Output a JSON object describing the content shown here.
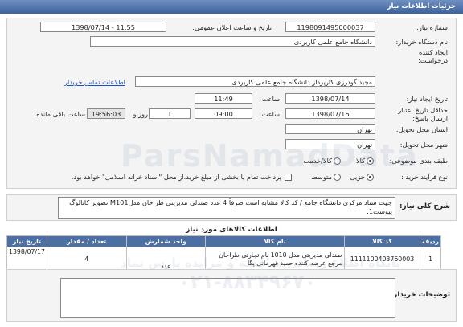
{
  "title": "جزئیات اطلاعات نیاز",
  "form": {
    "need_number": {
      "label": "شماره نیاز:",
      "value": "1198091495000037"
    },
    "announce_datetime": {
      "label": "تاریخ و ساعت اعلان عمومی:",
      "value": "1398/07/14 - 11:55"
    },
    "buyer_org": {
      "label": "نام دستگاه خریدار:",
      "value": "دانشگاه جامع علمی کاربردی"
    },
    "request_creator": {
      "label": "ایجاد کننده درخواست:",
      "value": "مجید گودرزی کارپرداز دانشگاه جامع علمی کاربردی",
      "contact_link": "اطلاعات تماس خریدار"
    },
    "need_creation_date": {
      "label": "تاریخ ایجاد نیاز:",
      "date": "1398/07/14",
      "time_label": "ساعت",
      "time": "11:49"
    },
    "response_deadline": {
      "label": "حداقل تاریخ اعتبار ارسال پاسخ:",
      "date": "1398/07/16",
      "time_label": "ساعت",
      "time": "09:00",
      "days": "1",
      "days_label": "روز و",
      "remaining": "19:56:03",
      "remaining_label": "ساعت باقی مانده"
    },
    "delivery_province": {
      "label": "استان محل تحویل:",
      "value": "تهران"
    },
    "delivery_city": {
      "label": "شهر محل تحویل:",
      "value": "تهران"
    },
    "category": {
      "label": "طبقه بندی موضوعی:",
      "options": [
        "کالا",
        "کالا/خدمت"
      ],
      "selected": "کالا"
    },
    "purchase_process": {
      "label": "نوع فرآیند خرید :",
      "options": [
        "جزیی",
        "متوسط"
      ],
      "selected": "جزیی",
      "checkbox_text": "پرداخت تمام یا بخشی از مبلغ خرید،از محل \"اسناد خزانه اسلامی\" خواهد بود."
    }
  },
  "general_description": {
    "label": "شرح کلی نیاز:",
    "text": "جهت ستاد مرکزی دانشگاه جامع / کد کالا مشابه است صرفاً  4 عدد صندلی مدیریتی طراحان مدلM101 تصویر کاتالوگ پیوست1."
  },
  "items_section": {
    "title": "اطلاعات کالاهای مورد نیاز",
    "columns": [
      "ردیف",
      "کد کالا",
      "نام کالا",
      "واحد شمارش",
      "تعداد / مقدار",
      "تاریخ نیاز"
    ],
    "rows": [
      [
        "1",
        "1111100403760003",
        "صندلی مدیریتی مدل 1010 نام تجارتی طراحان مرجع عرضه کننده حمید قهرمانی پگا",
        "عدد",
        "4",
        "1398/07/17"
      ]
    ]
  },
  "buyer_notes": {
    "label": "توضیحات خریدار:",
    "value": ""
  },
  "watermark": {
    "fa": "پایگاه اطلاع رسانی مناقصه و مزایده پارس نماد",
    "en": "ParsNamadData",
    "phone": "۰۲۱-۸۸۳۴۹۶۷۰"
  }
}
